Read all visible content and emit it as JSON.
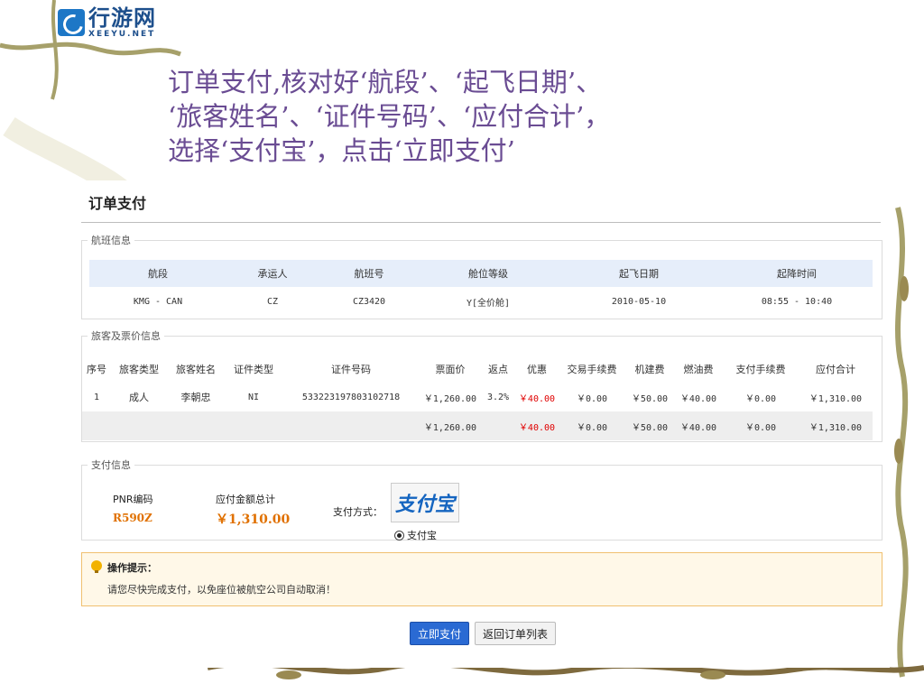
{
  "logo": {
    "cn": "行游网",
    "en": "XEEYU.NET"
  },
  "instruction": [
    "订单支付,核对好‘航段’、‘起飞日期’、",
    "‘旅客姓名’、‘证件号码’、‘应付合计’，",
    "选择‘支付宝’，点击‘立即支付’"
  ],
  "panel_title": "订单支付",
  "flight": {
    "legend": "航班信息",
    "headers": [
      "航段",
      "承运人",
      "航班号",
      "舱位等级",
      "起飞日期",
      "起降时间"
    ],
    "row": [
      "KMG - CAN",
      "CZ",
      "CZ3420",
      "Y[全价舱]",
      "2010-05-10",
      "08:55 - 10:40"
    ]
  },
  "passenger": {
    "legend": "旅客及票价信息",
    "headers": [
      "序号",
      "旅客类型",
      "旅客姓名",
      "证件类型",
      "证件号码",
      "票面价",
      "返点",
      "优惠",
      "交易手续费",
      "机建费",
      "燃油费",
      "支付手续费",
      "应付合计"
    ],
    "row": [
      "1",
      "成人",
      "李朝忠",
      "NI",
      "533223197803102718",
      "￥1,260.00",
      "3.2%",
      "￥40.00",
      "￥0.00",
      "￥50.00",
      "￥40.00",
      "￥0.00",
      "￥1,310.00"
    ],
    "total": [
      "￥1,260.00",
      "",
      "￥40.00",
      "￥0.00",
      "￥50.00",
      "￥40.00",
      "￥0.00",
      "￥1,310.00"
    ]
  },
  "payment": {
    "legend": "支付信息",
    "pnr_label": "PNR编码",
    "pnr_value": "R590Z",
    "amount_label": "应付金额总计",
    "amount_value": "￥1,310.00",
    "method_label": "支付方式：",
    "alipay_logo": "支付宝",
    "alipay_option": "支付宝"
  },
  "tip": {
    "title": "操作提示：",
    "text": "请您尽快完成支付，以免座位被航空公司自动取消！"
  },
  "buttons": {
    "pay": "立即支付",
    "back": "返回订单列表"
  },
  "colors": {
    "header_bg": "#e6eefa",
    "accent_orange": "#e07000",
    "discount_red": "#e00000",
    "pay_button": "#2a6ad3",
    "tip_bg": "#fff8e8"
  }
}
